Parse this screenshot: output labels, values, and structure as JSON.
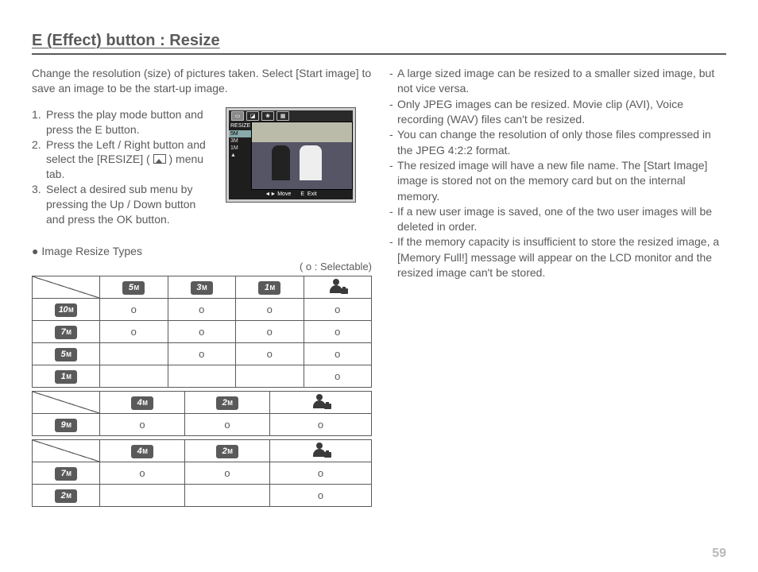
{
  "page": {
    "title": "E (Effect) button : Resize",
    "intro": "Change the resolution (size) of pictures taken. Select [Start image] to save an image to be the start-up image.",
    "number": "59"
  },
  "steps": [
    {
      "n": "1.",
      "t": "Press the play mode button and press the E button."
    },
    {
      "n": "2.",
      "t_pre": "Press the Left / Right  button and select the [RESIZE] ( ",
      "t_post": " ) menu tab."
    },
    {
      "n": "3.",
      "t": "Select a desired sub menu by pressing the Up / Down button and press the OK button."
    }
  ],
  "lcd": {
    "header": "RESIZE",
    "options": [
      "5M",
      "3M",
      "1M",
      ""
    ],
    "footer_left": "Move",
    "footer_right": "Exit",
    "footer_e": "E"
  },
  "legend_label": "Image Resize Types",
  "selectable_note": "( o : Selectable)",
  "o": "o",
  "sizes": {
    "s5": "5",
    "s3": "3",
    "s1": "1",
    "s10": "10",
    "s7": "7",
    "s4": "4",
    "s2": "2",
    "s9": "9",
    "M": "M"
  },
  "table1": {
    "cols": [
      "5M",
      "3M",
      "1M",
      "person"
    ],
    "rows": [
      {
        "h": "10M",
        "c": [
          "o",
          "o",
          "o",
          "o"
        ]
      },
      {
        "h": "7M",
        "c": [
          "o",
          "o",
          "o",
          "o"
        ]
      },
      {
        "h": "5M",
        "c": [
          "",
          "o",
          "o",
          "o"
        ]
      },
      {
        "h": "1M",
        "c": [
          "",
          "",
          "",
          "o"
        ]
      }
    ]
  },
  "table2": {
    "cols": [
      "4M",
      "2M",
      "person"
    ],
    "rows": [
      {
        "h": "9M",
        "c": [
          "o",
          "o",
          "o"
        ]
      }
    ]
  },
  "table3": {
    "cols": [
      "4M",
      "2M",
      "person"
    ],
    "rows": [
      {
        "h": "7M",
        "c": [
          "o",
          "o",
          "o"
        ]
      },
      {
        "h": "2M",
        "c": [
          "",
          "",
          "o"
        ]
      }
    ]
  },
  "notes": [
    "A large sized image can be resized to a smaller sized image, but not vice versa.",
    "Only JPEG images can be resized. Movie clip (AVI), Voice recording (WAV) files can't be resized.",
    "You can change the resolution of only those files compressed in the JPEG 4:2:2 format.",
    " The resized image will have a new file name. The [Start Image] image is stored not on the memory card but on the internal memory.",
    "If a new user image is saved, one of the two user images will be deleted in order.",
    "If the memory capacity is insufficient to store the resized image, a [Memory Full!] message will appear on the LCD monitor and the resized image can't be stored."
  ]
}
